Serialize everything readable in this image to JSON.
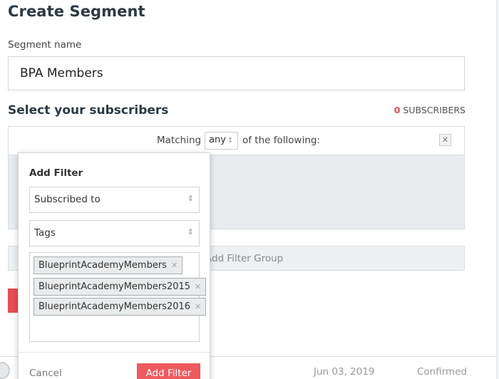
{
  "page": {
    "title": "Create Segment",
    "segment_name_label": "Segment name",
    "segment_name_value": "BPA Members",
    "select_title": "Select your subscribers",
    "subscribers_count": "0",
    "subscribers_label": "SUBSCRIBERS"
  },
  "matching": {
    "prefix": "Matching",
    "mode": "any",
    "suffix": "of the following:"
  },
  "filter_group": {
    "label": "Add Filter Group"
  },
  "popover": {
    "title": "Add Filter",
    "field_select": "Subscribed to",
    "type_select": "Tags",
    "tags": [
      "BlueprintAcademyMembers",
      "BlueprintAcademyMembers2015",
      "BlueprintAcademyMembers2016"
    ],
    "cancel_label": "Cancel",
    "add_label": "Add Filter"
  },
  "row": {
    "date": "Jun 03, 2019",
    "status": "Confirmed"
  },
  "colors": {
    "accent": "#ef5a5f",
    "count": "#e84c52"
  },
  "icons": {
    "select_arrows": "updown-icon",
    "remove": "close-icon"
  }
}
